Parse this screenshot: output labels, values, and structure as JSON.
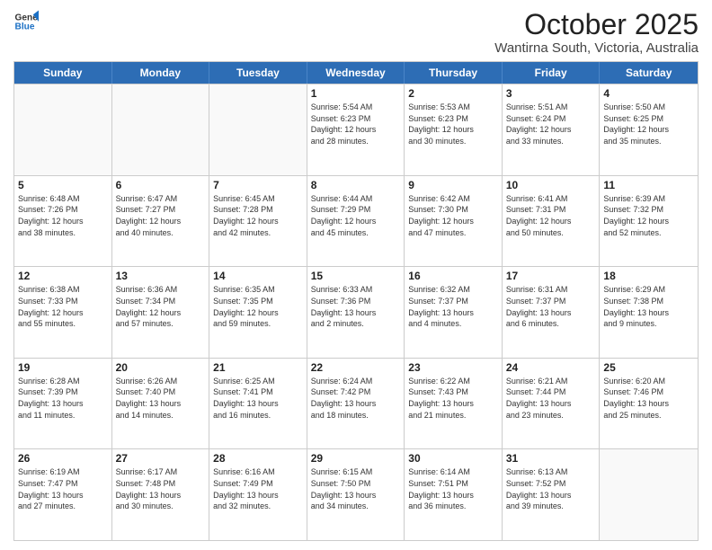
{
  "logo": {
    "line1": "General",
    "line2": "Blue"
  },
  "title": "October 2025",
  "subtitle": "Wantirna South, Victoria, Australia",
  "header_days": [
    "Sunday",
    "Monday",
    "Tuesday",
    "Wednesday",
    "Thursday",
    "Friday",
    "Saturday"
  ],
  "rows": [
    [
      {
        "day": "",
        "info": "",
        "empty": true
      },
      {
        "day": "",
        "info": "",
        "empty": true
      },
      {
        "day": "",
        "info": "",
        "empty": true
      },
      {
        "day": "1",
        "info": "Sunrise: 5:54 AM\nSunset: 6:23 PM\nDaylight: 12 hours\nand 28 minutes.",
        "empty": false
      },
      {
        "day": "2",
        "info": "Sunrise: 5:53 AM\nSunset: 6:23 PM\nDaylight: 12 hours\nand 30 minutes.",
        "empty": false
      },
      {
        "day": "3",
        "info": "Sunrise: 5:51 AM\nSunset: 6:24 PM\nDaylight: 12 hours\nand 33 minutes.",
        "empty": false
      },
      {
        "day": "4",
        "info": "Sunrise: 5:50 AM\nSunset: 6:25 PM\nDaylight: 12 hours\nand 35 minutes.",
        "empty": false
      }
    ],
    [
      {
        "day": "5",
        "info": "Sunrise: 6:48 AM\nSunset: 7:26 PM\nDaylight: 12 hours\nand 38 minutes.",
        "empty": false
      },
      {
        "day": "6",
        "info": "Sunrise: 6:47 AM\nSunset: 7:27 PM\nDaylight: 12 hours\nand 40 minutes.",
        "empty": false
      },
      {
        "day": "7",
        "info": "Sunrise: 6:45 AM\nSunset: 7:28 PM\nDaylight: 12 hours\nand 42 minutes.",
        "empty": false
      },
      {
        "day": "8",
        "info": "Sunrise: 6:44 AM\nSunset: 7:29 PM\nDaylight: 12 hours\nand 45 minutes.",
        "empty": false
      },
      {
        "day": "9",
        "info": "Sunrise: 6:42 AM\nSunset: 7:30 PM\nDaylight: 12 hours\nand 47 minutes.",
        "empty": false
      },
      {
        "day": "10",
        "info": "Sunrise: 6:41 AM\nSunset: 7:31 PM\nDaylight: 12 hours\nand 50 minutes.",
        "empty": false
      },
      {
        "day": "11",
        "info": "Sunrise: 6:39 AM\nSunset: 7:32 PM\nDaylight: 12 hours\nand 52 minutes.",
        "empty": false
      }
    ],
    [
      {
        "day": "12",
        "info": "Sunrise: 6:38 AM\nSunset: 7:33 PM\nDaylight: 12 hours\nand 55 minutes.",
        "empty": false
      },
      {
        "day": "13",
        "info": "Sunrise: 6:36 AM\nSunset: 7:34 PM\nDaylight: 12 hours\nand 57 minutes.",
        "empty": false
      },
      {
        "day": "14",
        "info": "Sunrise: 6:35 AM\nSunset: 7:35 PM\nDaylight: 12 hours\nand 59 minutes.",
        "empty": false
      },
      {
        "day": "15",
        "info": "Sunrise: 6:33 AM\nSunset: 7:36 PM\nDaylight: 13 hours\nand 2 minutes.",
        "empty": false
      },
      {
        "day": "16",
        "info": "Sunrise: 6:32 AM\nSunset: 7:37 PM\nDaylight: 13 hours\nand 4 minutes.",
        "empty": false
      },
      {
        "day": "17",
        "info": "Sunrise: 6:31 AM\nSunset: 7:37 PM\nDaylight: 13 hours\nand 6 minutes.",
        "empty": false
      },
      {
        "day": "18",
        "info": "Sunrise: 6:29 AM\nSunset: 7:38 PM\nDaylight: 13 hours\nand 9 minutes.",
        "empty": false
      }
    ],
    [
      {
        "day": "19",
        "info": "Sunrise: 6:28 AM\nSunset: 7:39 PM\nDaylight: 13 hours\nand 11 minutes.",
        "empty": false
      },
      {
        "day": "20",
        "info": "Sunrise: 6:26 AM\nSunset: 7:40 PM\nDaylight: 13 hours\nand 14 minutes.",
        "empty": false
      },
      {
        "day": "21",
        "info": "Sunrise: 6:25 AM\nSunset: 7:41 PM\nDaylight: 13 hours\nand 16 minutes.",
        "empty": false
      },
      {
        "day": "22",
        "info": "Sunrise: 6:24 AM\nSunset: 7:42 PM\nDaylight: 13 hours\nand 18 minutes.",
        "empty": false
      },
      {
        "day": "23",
        "info": "Sunrise: 6:22 AM\nSunset: 7:43 PM\nDaylight: 13 hours\nand 21 minutes.",
        "empty": false
      },
      {
        "day": "24",
        "info": "Sunrise: 6:21 AM\nSunset: 7:44 PM\nDaylight: 13 hours\nand 23 minutes.",
        "empty": false
      },
      {
        "day": "25",
        "info": "Sunrise: 6:20 AM\nSunset: 7:46 PM\nDaylight: 13 hours\nand 25 minutes.",
        "empty": false
      }
    ],
    [
      {
        "day": "26",
        "info": "Sunrise: 6:19 AM\nSunset: 7:47 PM\nDaylight: 13 hours\nand 27 minutes.",
        "empty": false
      },
      {
        "day": "27",
        "info": "Sunrise: 6:17 AM\nSunset: 7:48 PM\nDaylight: 13 hours\nand 30 minutes.",
        "empty": false
      },
      {
        "day": "28",
        "info": "Sunrise: 6:16 AM\nSunset: 7:49 PM\nDaylight: 13 hours\nand 32 minutes.",
        "empty": false
      },
      {
        "day": "29",
        "info": "Sunrise: 6:15 AM\nSunset: 7:50 PM\nDaylight: 13 hours\nand 34 minutes.",
        "empty": false
      },
      {
        "day": "30",
        "info": "Sunrise: 6:14 AM\nSunset: 7:51 PM\nDaylight: 13 hours\nand 36 minutes.",
        "empty": false
      },
      {
        "day": "31",
        "info": "Sunrise: 6:13 AM\nSunset: 7:52 PM\nDaylight: 13 hours\nand 39 minutes.",
        "empty": false
      },
      {
        "day": "",
        "info": "",
        "empty": true
      }
    ]
  ]
}
